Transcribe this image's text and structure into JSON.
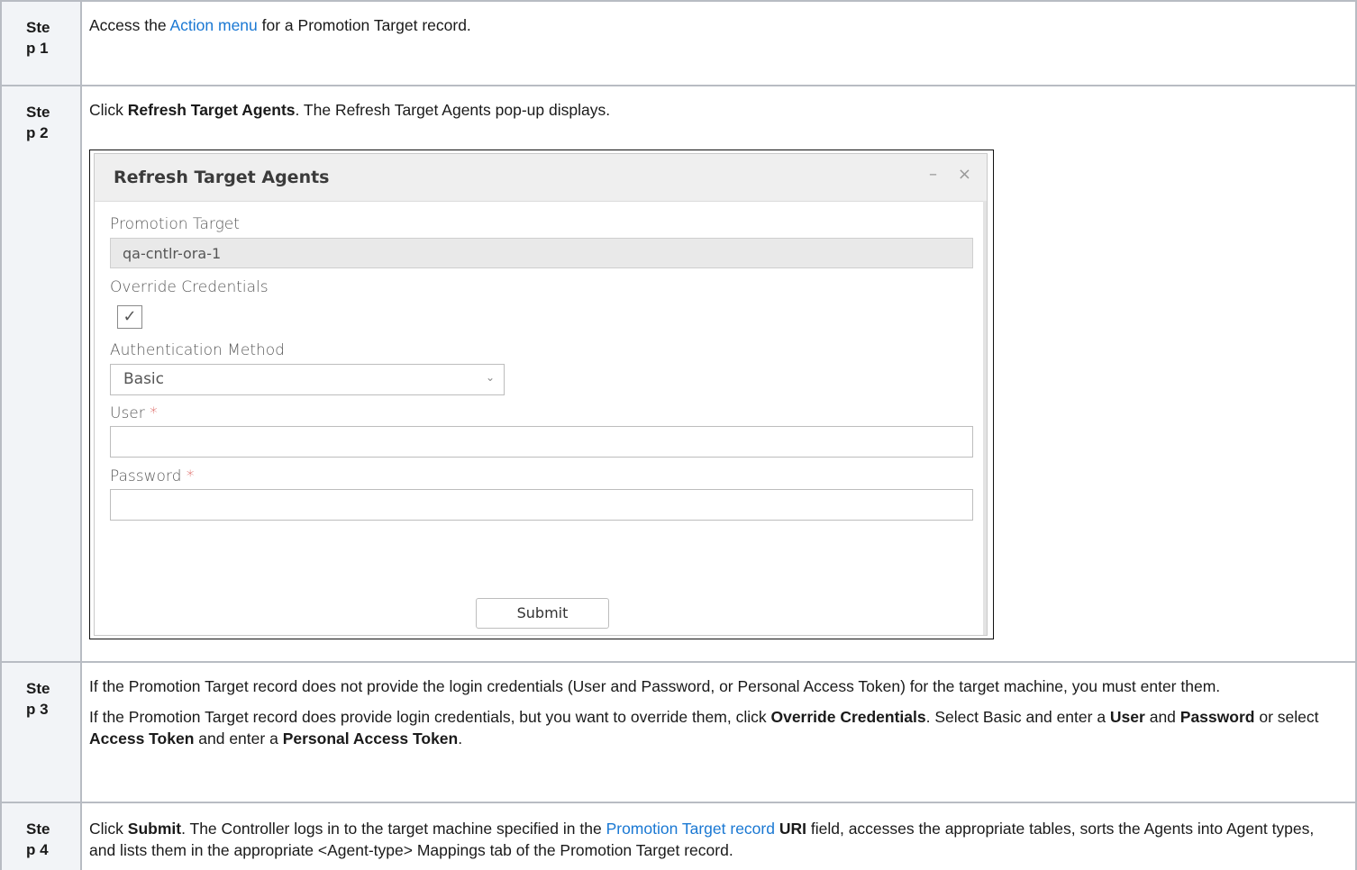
{
  "steps": [
    {
      "num_line1": "Ste",
      "num_line2": "p 1",
      "text_a": "Access the ",
      "link": "Action menu",
      "text_b": " for a Promotion Target record."
    },
    {
      "num_line1": "Ste",
      "num_line2": "p 2",
      "text_a": "Click ",
      "bold": "Refresh Target Agents",
      "text_b": ". The Refresh Target Agents pop-up displays."
    },
    {
      "num_line1": "Ste",
      "num_line2": "p 3",
      "para1": "If the Promotion Target record does not provide the login credentials (User and Password, or Personal Access Token) for the target machine, you must enter them.",
      "p2_a": "If the Promotion Target record does provide login credentials, but you want to override them, click ",
      "p2_b1": "Override Credentials",
      "p2_c": ". Select Basic and enter a ",
      "p2_b2": "User",
      "p2_d": " and ",
      "p2_b3": "Password",
      "p2_e": " or select ",
      "p2_b4": "Access Token",
      "p2_f": " and enter a ",
      "p2_b5": "Personal Access Token",
      "p2_g": "."
    },
    {
      "num_line1": "Ste",
      "num_line2": "p 4",
      "text_a": "Click ",
      "bold1": "Submit",
      "text_b": ". The Controller logs in to the target machine specified in the ",
      "link": "Promotion Target record",
      "text_c": " ",
      "bold2": "URI",
      "text_d": " field, accesses the appropriate tables, sorts the Agents into Agent types, and lists them in the appropriate <Agent-type> Mappings tab of the Promotion Target record."
    }
  ],
  "dialog": {
    "title": "Refresh Target Agents",
    "minimize_glyph": "–",
    "close_glyph": "×",
    "promotion_target_label": "Promotion Target",
    "promotion_target_value": "qa-cntlr-ora-1",
    "override_label": "Override Credentials",
    "override_checked": "✓",
    "auth_label": "Authentication Method",
    "auth_value": "Basic",
    "user_label": "User",
    "password_label": "Password",
    "required_mark": "*",
    "submit_label": "Submit"
  }
}
